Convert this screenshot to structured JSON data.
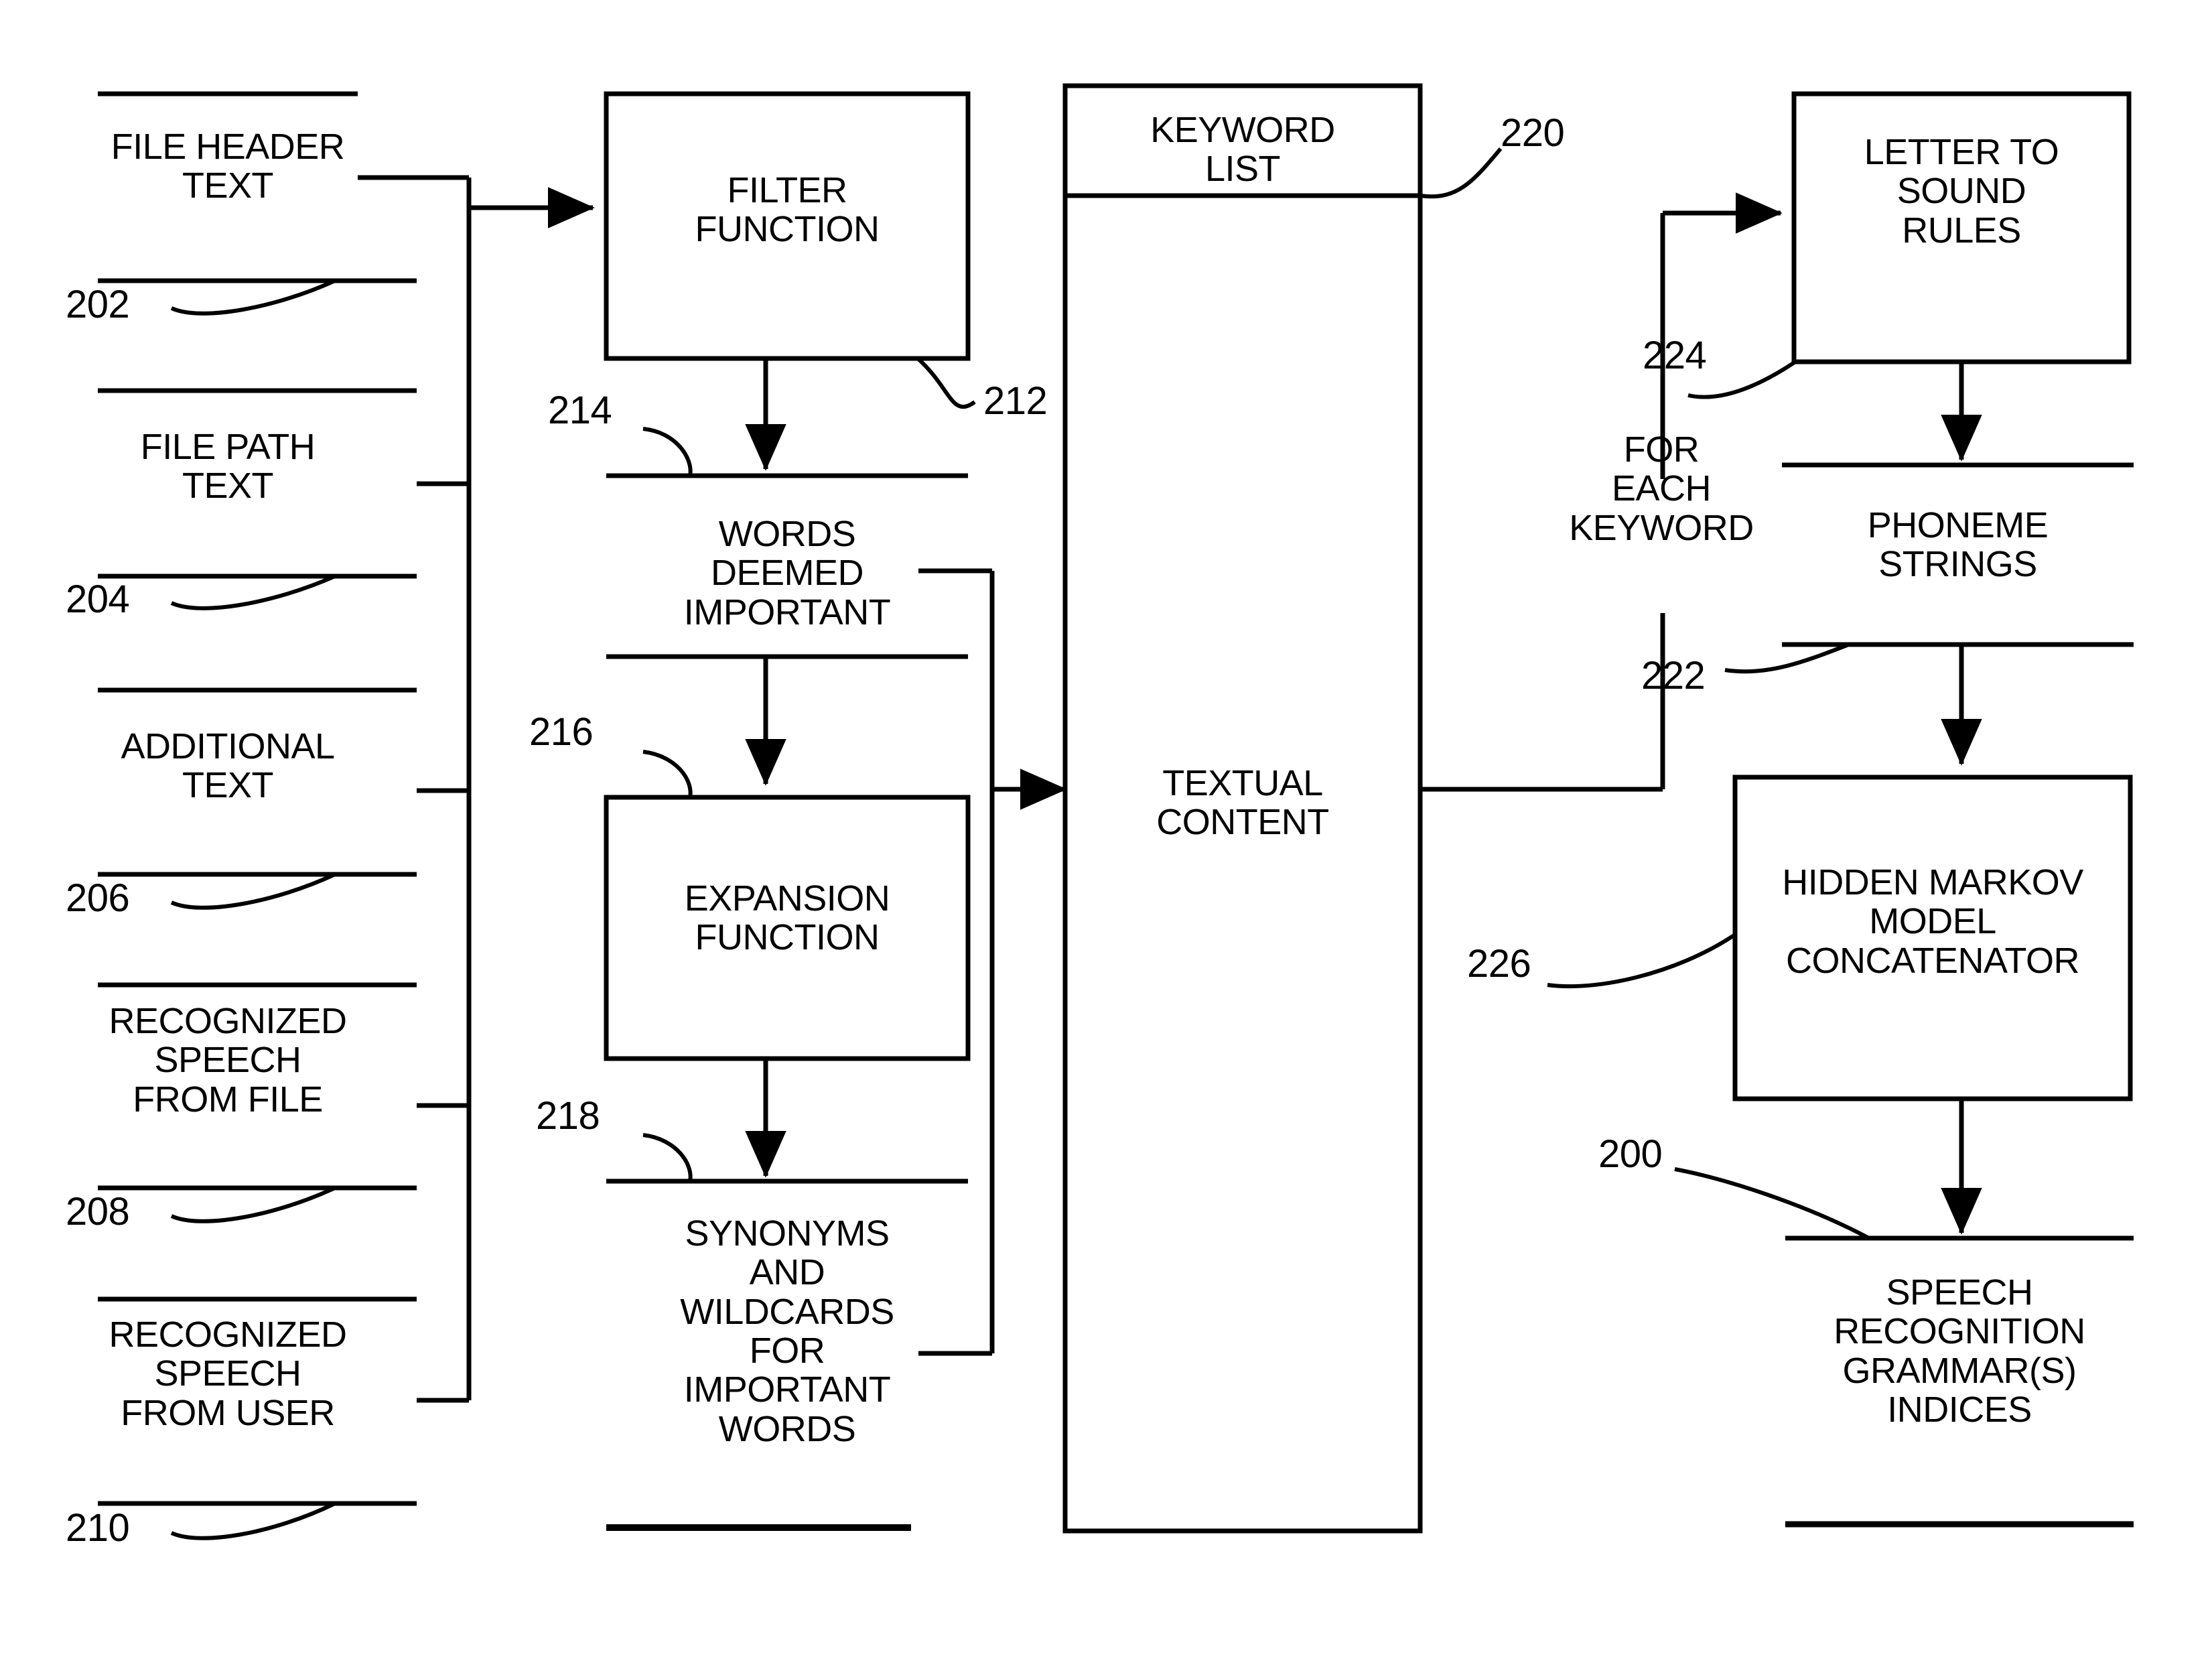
{
  "diagram": {
    "type": "patent-block-flow-diagram",
    "background_color": "#ffffff",
    "stroke_color": "#000000"
  },
  "inputs": [
    {
      "label": "FILE HEADER\nTEXT",
      "ref": "202"
    },
    {
      "label": "FILE PATH\nTEXT",
      "ref": "204"
    },
    {
      "label": "ADDITIONAL\nTEXT",
      "ref": "206"
    },
    {
      "label": "RECOGNIZED\nSPEECH\nFROM FILE",
      "ref": "208"
    },
    {
      "label": "RECOGNIZED\nSPEECH\nFROM USER",
      "ref": "210"
    }
  ],
  "process_column": {
    "filter_function": {
      "label": "FILTER\nFUNCTION",
      "ref": "212"
    },
    "words_deemed_important": {
      "label": "WORDS\nDEEMED\nIMPORTANT",
      "ref": "214"
    },
    "expansion_function": {
      "label": "EXPANSION\nFUNCTION",
      "ref": "216"
    },
    "synonyms_wildcards": {
      "label": "SYNONYMS\nAND\nWILDCARDS\nFOR\nIMPORTANT\nWORDS",
      "ref": "218"
    }
  },
  "center": {
    "keyword_list": {
      "label": "KEYWORD\nLIST",
      "ref": "220"
    },
    "textual_content": {
      "label": "TEXTUAL\nCONTENT"
    }
  },
  "loop": {
    "label": "FOR\nEACH\nKEYWORD"
  },
  "right_column": {
    "letter_to_sound_rules": {
      "label": "LETTER TO\nSOUND\nRULES",
      "ref": "224"
    },
    "phoneme_strings": {
      "label": "PHONEME\nSTRINGS",
      "ref": "222"
    },
    "hmm_concatenator": {
      "label": "HIDDEN MARKOV\nMODEL\nCONCATENATOR",
      "ref": "226"
    },
    "grammar_indices": {
      "label": "SPEECH\nRECOGNITION\nGRAMMAR(S)\nINDICES",
      "ref": "200"
    }
  }
}
